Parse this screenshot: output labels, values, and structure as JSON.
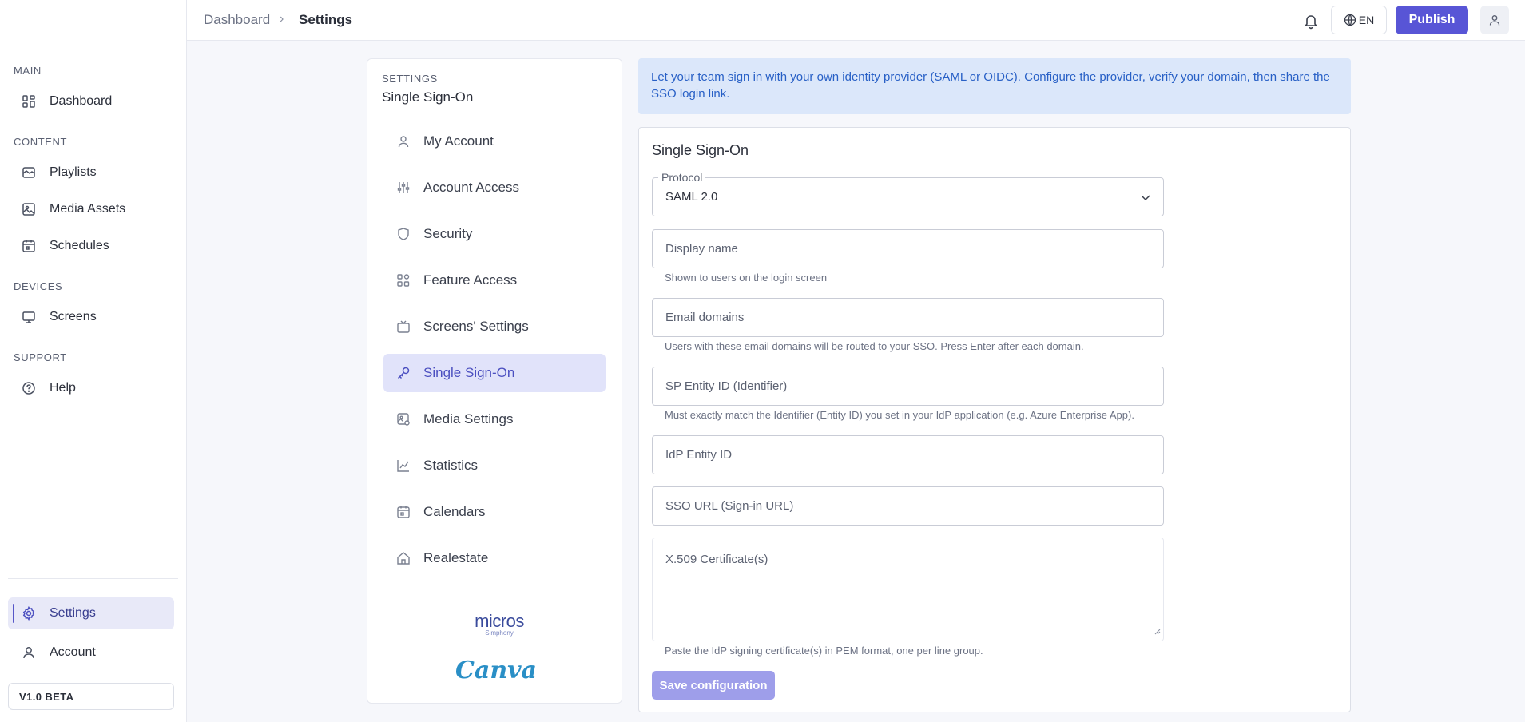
{
  "sidebar": {
    "sections": {
      "main": "MAIN",
      "content": "CONTENT",
      "devices": "DEVICES",
      "support": "SUPPORT"
    },
    "items": {
      "dashboard": "Dashboard",
      "playlists": "Playlists",
      "media_assets": "Media Assets",
      "schedules": "Schedules",
      "screens": "Screens",
      "help": "Help",
      "settings": "Settings",
      "account": "Account"
    },
    "version": "V1.0 BETA"
  },
  "topbar": {
    "breadcrumb": {
      "home": "Dashboard",
      "separator": "›",
      "current": "Settings"
    },
    "language": "EN",
    "publish": "Publish"
  },
  "settings_menu": {
    "eyebrow": "SETTINGS",
    "title": "Single Sign-On",
    "items": {
      "my_account": "My Account",
      "account_access": "Account Access",
      "security": "Security",
      "feature_access": "Feature Access",
      "screens_settings": "Screens' Settings",
      "single_sign_on": "Single Sign-On",
      "media_settings": "Media Settings",
      "statistics": "Statistics",
      "calendars": "Calendars",
      "realestate": "Realestate"
    },
    "logos": {
      "micros": "micros",
      "micros_sub": "Simphony",
      "canva": "Canva"
    }
  },
  "main": {
    "banner": "Let your team sign in with your own identity provider (SAML or OIDC). Configure the provider, verify your domain, then share the SSO login link.",
    "form": {
      "title": "Single Sign-On",
      "protocol_label": "Protocol",
      "protocol_value": "SAML 2.0",
      "display_name_placeholder": "Display name",
      "display_name_help": "Shown to users on the login screen",
      "email_domains_placeholder": "Email domains",
      "email_domains_help": "Users with these email domains will be routed to your SSO. Press Enter after each domain.",
      "sp_entity_placeholder": "SP Entity ID (Identifier)",
      "sp_entity_help": "Must exactly match the Identifier (Entity ID) you set in your IdP application (e.g. Azure Enterprise App).",
      "idp_entity_placeholder": "IdP Entity ID",
      "sso_url_placeholder": "SSO URL (Sign-in URL)",
      "certificate_placeholder": "X.509 Certificate(s)",
      "certificate_help": "Paste the IdP signing certificate(s) in PEM format, one per line group.",
      "save_label": "Save configuration"
    }
  },
  "colors": {
    "accent": "#5855d6",
    "active_bg": "#e1e3fa",
    "banner_bg": "#dbe7fa",
    "banner_text": "#2860c6",
    "save_disabled": "#9e9eea"
  }
}
